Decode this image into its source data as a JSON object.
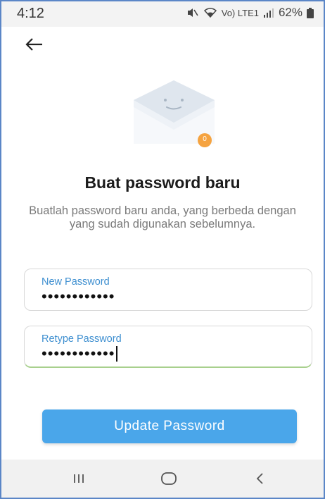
{
  "status_bar": {
    "time": "4:12",
    "indicators": "🔇︎",
    "network": "Vo) LTE1",
    "battery": "62%"
  },
  "icons": {
    "back": "arrow-left-icon",
    "illustration": "envelope-smile-icon",
    "battery": "battery-icon",
    "nav_recent": "recent-apps-icon",
    "nav_home": "home-icon",
    "nav_back": "chevron-left-icon"
  },
  "illustration": {
    "badge": "0"
  },
  "page": {
    "title": "Buat password baru",
    "subtitle": "Buatlah password baru anda, yang berbeda dengan yang sudah digunakan sebelumnya."
  },
  "form": {
    "new_password": {
      "label": "New Password",
      "value": "••••••••••••"
    },
    "retype_password": {
      "label": "Retype Password",
      "value": "••••••••••••"
    },
    "submit_label": "Update Password"
  },
  "colors": {
    "accent": "#4aa6ea",
    "label": "#3e8fd0",
    "badge": "#f5a340",
    "focus_underline": "#a8d08d"
  }
}
